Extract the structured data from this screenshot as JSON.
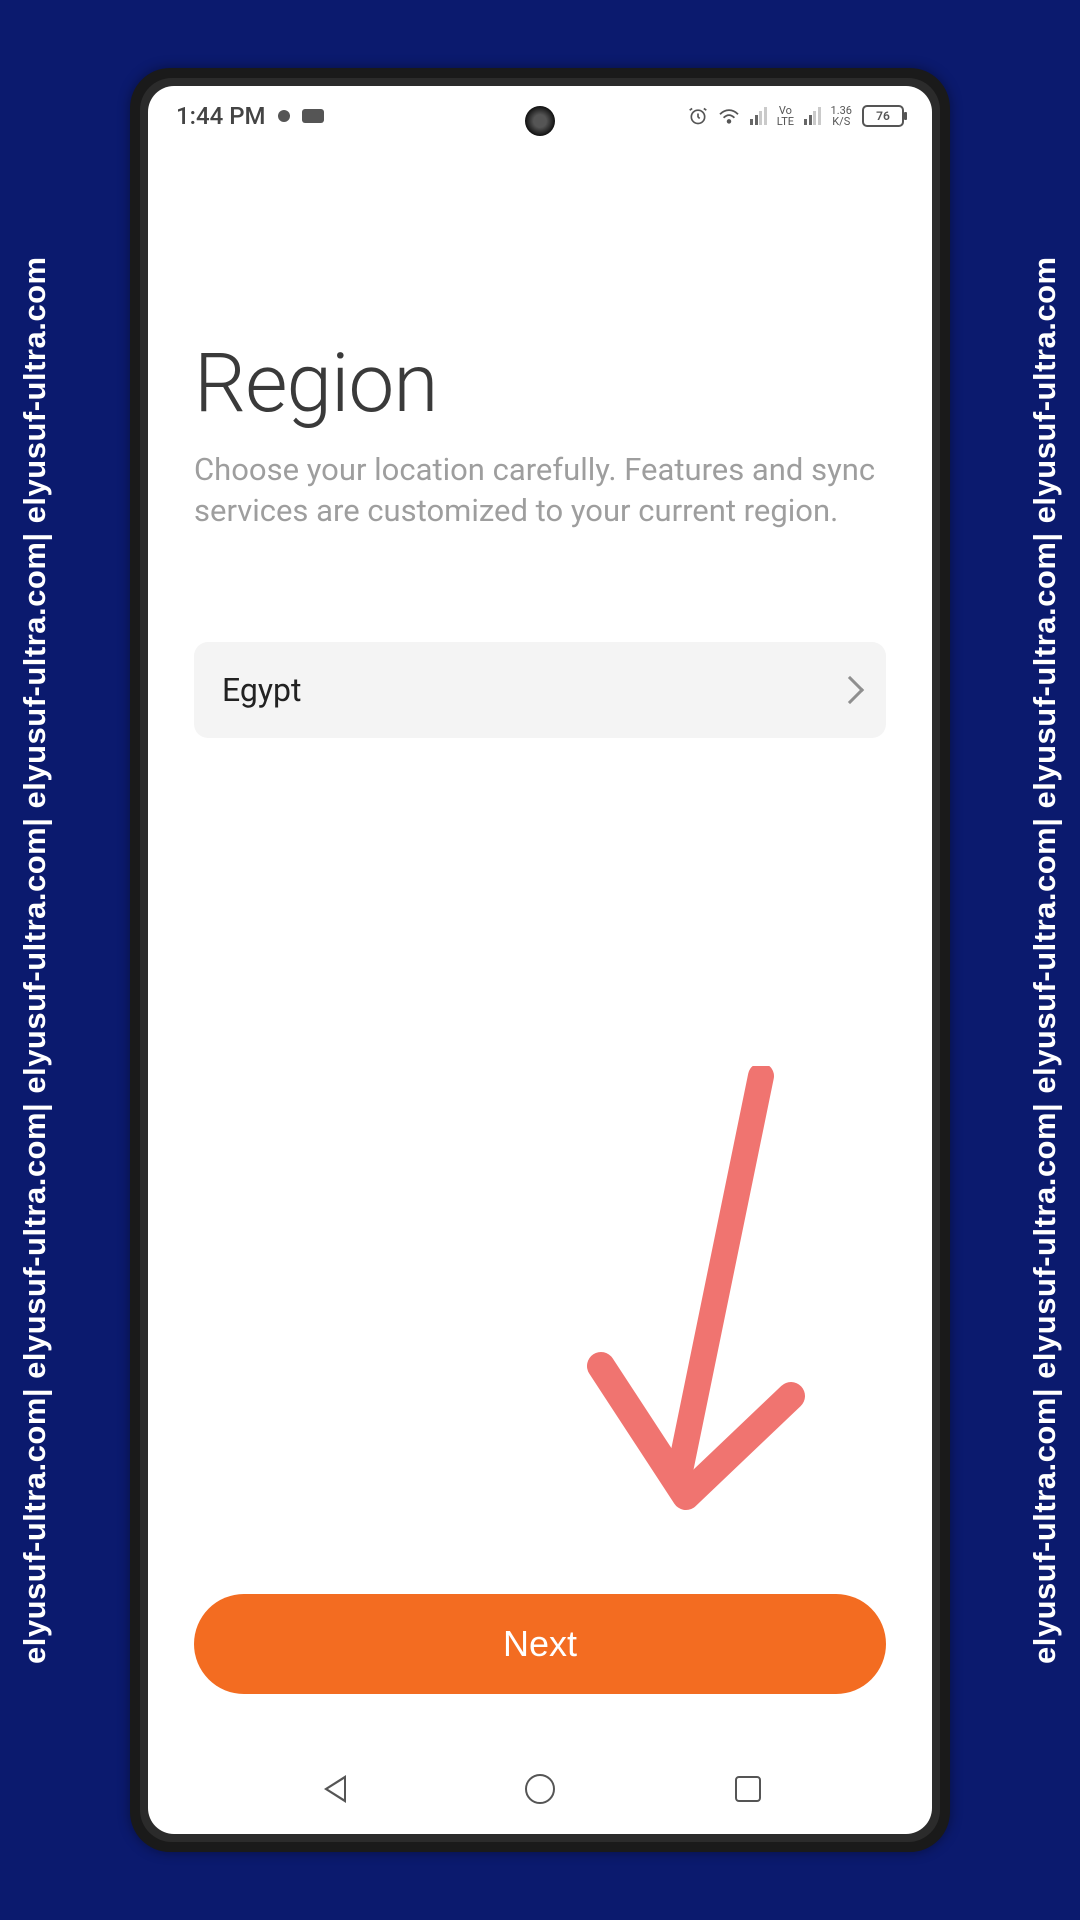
{
  "watermark_text": "elyusuf-ultra.com| elyusuf-ultra.com| elyusuf-ultra.com| elyusuf-ultra.com| elyusuf-ultra.com",
  "statusbar": {
    "time": "1:44 PM",
    "battery_level": "76",
    "lte_label": "LTE",
    "volte_label": "Vo",
    "net_label": "1.36\nK/S"
  },
  "page": {
    "heading": "Region",
    "subtext": "Choose your location carefully. Features and sync services are customized to your current region."
  },
  "region_selector": {
    "selected": "Egypt"
  },
  "buttons": {
    "next_label": "Next"
  }
}
